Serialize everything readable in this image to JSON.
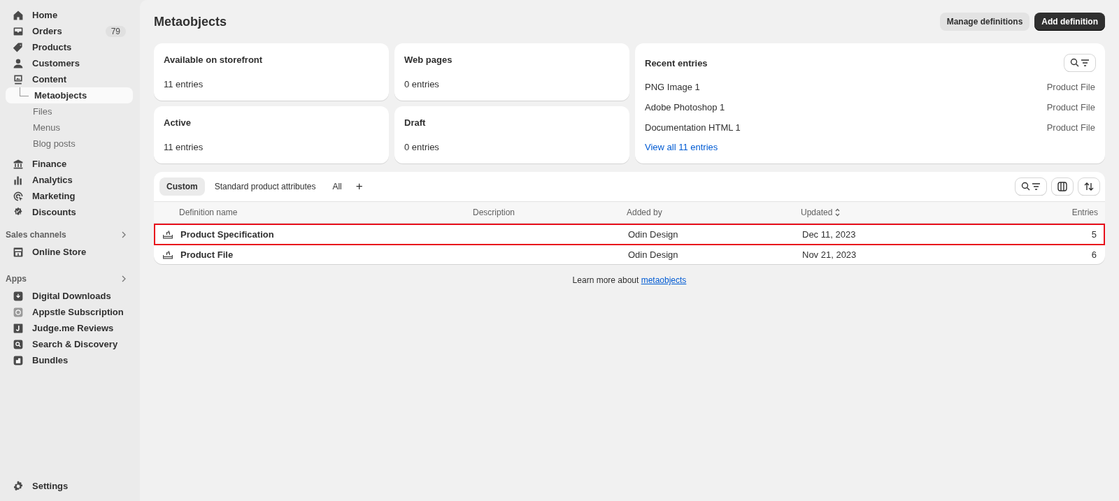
{
  "sidebar": {
    "items": [
      {
        "label": "Home",
        "selected": false
      },
      {
        "label": "Orders",
        "badge": "79",
        "selected": false
      },
      {
        "label": "Products",
        "selected": false
      },
      {
        "label": "Customers",
        "selected": false
      },
      {
        "label": "Content",
        "selected": false,
        "children": [
          {
            "label": "Metaobjects",
            "selected": true
          },
          {
            "label": "Files",
            "selected": false
          },
          {
            "label": "Menus",
            "selected": false
          },
          {
            "label": "Blog posts",
            "selected": false
          }
        ]
      },
      {
        "label": "Finance",
        "selected": false
      },
      {
        "label": "Analytics",
        "selected": false
      },
      {
        "label": "Marketing",
        "selected": false
      },
      {
        "label": "Discounts",
        "selected": false
      }
    ],
    "sections": [
      {
        "title": "Sales channels",
        "items": [
          {
            "label": "Online Store",
            "selected": false
          }
        ]
      },
      {
        "title": "Apps",
        "items": [
          {
            "label": "Digital Downloads",
            "selected": false
          },
          {
            "label": "Appstle Subscription",
            "selected": false
          },
          {
            "label": "Judge.me Reviews",
            "selected": false
          },
          {
            "label": "Search & Discovery",
            "selected": false
          },
          {
            "label": "Bundles",
            "selected": false
          }
        ]
      }
    ],
    "footer": {
      "label": "Settings"
    }
  },
  "page": {
    "title": "Metaobjects",
    "buttons": [
      {
        "label": "Manage definitions",
        "kind": "secondary"
      },
      {
        "label": "Add definition",
        "kind": "primary"
      }
    ]
  },
  "stats": [
    {
      "title": "Available on storefront",
      "value": "11 entries"
    },
    {
      "title": "Web pages",
      "value": "0 entries"
    },
    {
      "title": "Active",
      "value": "11 entries"
    },
    {
      "title": "Draft",
      "value": "0 entries"
    }
  ],
  "recent": {
    "title": "Recent entries",
    "entries": [
      {
        "name": "PNG Image 1",
        "type": "Product File"
      },
      {
        "name": "Adobe Photoshop 1",
        "type": "Product File"
      },
      {
        "name": "Documentation HTML 1",
        "type": "Product File"
      }
    ],
    "link": "View all 11 entries"
  },
  "tabs": [
    {
      "label": "Custom",
      "selected": true
    },
    {
      "label": "Standard product attributes",
      "selected": false
    },
    {
      "label": "All",
      "selected": false
    }
  ],
  "add_tab": "+",
  "table": {
    "columns": [
      {
        "label": "Definition name",
        "sortable": false
      },
      {
        "label": "Description",
        "sortable": false
      },
      {
        "label": "Added by",
        "sortable": false
      },
      {
        "label": "Updated",
        "sortable": true
      },
      {
        "label": "Entries",
        "sortable": false
      }
    ],
    "rows": [
      {
        "name": "Product Specification",
        "added_by": "Odin Design",
        "updated": "Dec 11, 2023",
        "entries": "5",
        "highlighted": true
      },
      {
        "name": "Product File",
        "added_by": "Odin Design",
        "updated": "Nov 21, 2023",
        "entries": "6",
        "highlighted": false
      }
    ]
  },
  "footer_note": {
    "text": "Learn more about ",
    "link": "metaobjects"
  }
}
